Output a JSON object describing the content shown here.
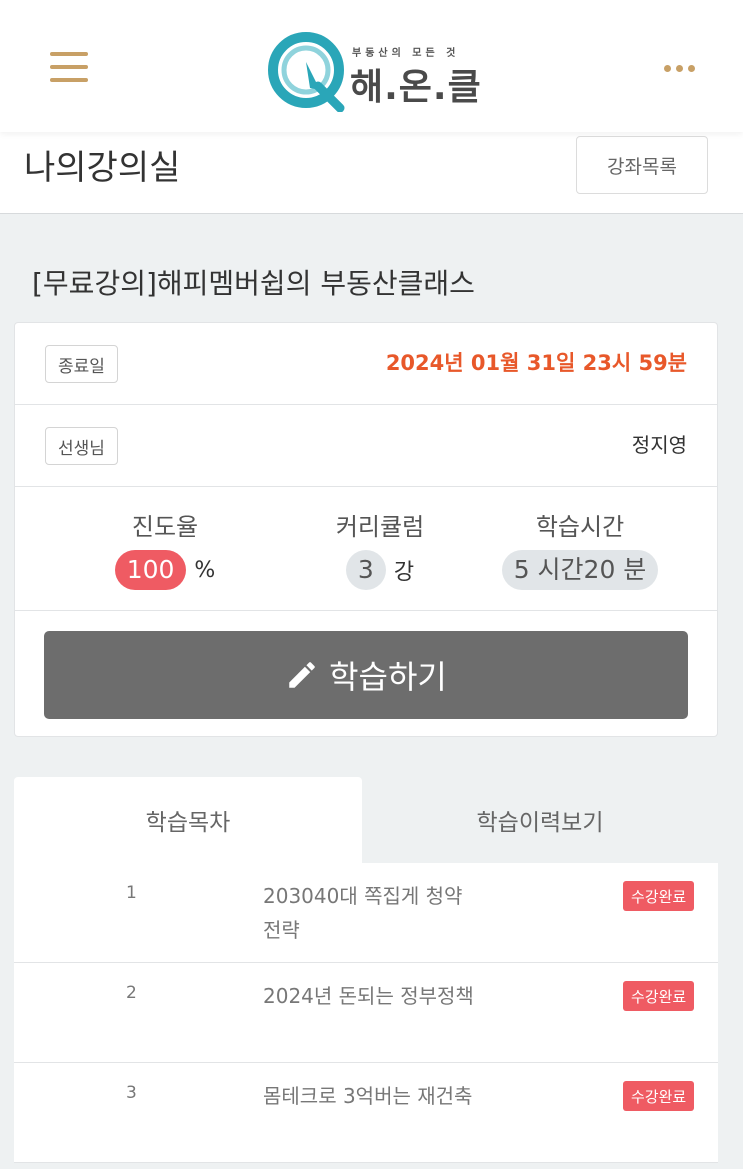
{
  "header": {
    "logo_subtitle": "부동산의 모든 것",
    "logo_title": "해.온.클"
  },
  "page": {
    "title": "나의강의실",
    "course_list_button": "강좌목록"
  },
  "course": {
    "title": "[무료강의]해피멤버쉽의 부동산클래스",
    "end_date_label": "종료일",
    "end_date_value": "2024년 01월 31일 23시 59분",
    "teacher_label": "선생님",
    "teacher_value": "정지영",
    "progress_label": "진도율",
    "progress_value": "100",
    "progress_unit": "%",
    "curriculum_label": "커리큘럼",
    "curriculum_value": "3",
    "curriculum_unit": "강",
    "study_time_label": "학습시간",
    "study_time_value": "5 시간20 분",
    "study_button": "학습하기"
  },
  "tabs": [
    {
      "label": "학습목차",
      "active": true
    },
    {
      "label": "학습이력보기",
      "active": false
    }
  ],
  "lessons": [
    {
      "number": "1",
      "title": "203040대 쪽집게 청약전략",
      "status": "수강완료"
    },
    {
      "number": "2",
      "title": "2024년 돈되는 정부정책",
      "status": "수강완료"
    },
    {
      "number": "3",
      "title": "몸테크로 3억버는 재건축",
      "status": "수강완료"
    }
  ],
  "colors": {
    "accent_gold": "#c8a066",
    "date_orange": "#e8582a",
    "badge_red": "#ef5b63",
    "button_grey": "#6d6d6d",
    "logo_teal": "#2aa6b8"
  },
  "icons": {
    "menu": "hamburger-icon",
    "more": "more-dots-icon",
    "study": "pencil-icon"
  }
}
